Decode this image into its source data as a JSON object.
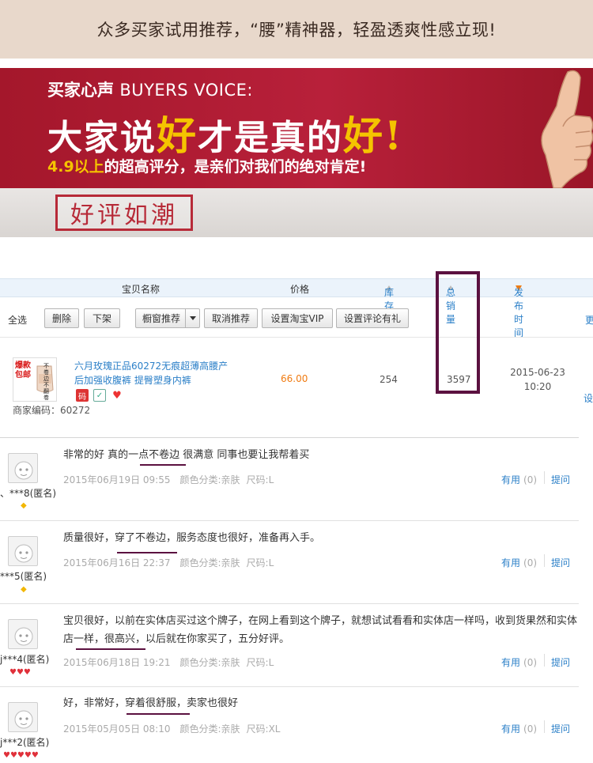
{
  "banner": {
    "text": "众多买家试用推荐，“腰”精神器，轻盈透爽性感立现!"
  },
  "voice": {
    "label_cn": "买家心声",
    "label_en": "BUYERS VOICE:",
    "headline_pre": "大家说",
    "headline_hl1": "好",
    "headline_mid": "才是真的",
    "headline_hl2": "好",
    "headline_end": "!",
    "sub_hl": "4.9以上",
    "sub_rest": "的超高评分，是亲们对我们的绝对肯定!",
    "stamp": "好评如潮"
  },
  "table": {
    "col_name": "宝贝名称",
    "col_price": "价格",
    "col_stock": "库存",
    "col_sales": "总销量",
    "col_date": "发布时间"
  },
  "toolbar": {
    "select_all": "全选",
    "delete": "删除",
    "offshelf": "下架",
    "window_recommend": "橱窗推荐",
    "cancel_recommend": "取消推荐",
    "set_vip": "设置淘宝VIP",
    "set_review_gift": "设置评论有礼",
    "more": "更"
  },
  "product": {
    "title": "六月玫瑰正品60272无痕超薄高腰产后加强收腹裤 提臀塑身内裤",
    "image_text_red": "爆款包邮",
    "image_text_black": "不卷边不翻卷",
    "icon_code": "码",
    "code": "商家编码：60272",
    "price": "66.00",
    "stock": "254",
    "sales": "3597",
    "date": "2015-06-23",
    "time": "10:20",
    "edit_cut": "设"
  },
  "reviews": [
    {
      "user": "、***8(匿名)",
      "text": "非常的好 真的一点不卷边 很满意 同事也要让我帮着买",
      "date": "2015年06月19日 09:55",
      "color": "颜色分类:亲肤",
      "size": "尺码:L",
      "useful_label": "有用",
      "useful_count": "(0)",
      "ask": "提问",
      "badge": "◆"
    },
    {
      "user": "***5(匿名)",
      "text": "质量很好，穿了不卷边，服务态度也很好，准备再入手。",
      "date": "2015年06月16日 22:37",
      "color": "颜色分类:亲肤",
      "size": "尺码:L",
      "useful_label": "有用",
      "useful_count": "(0)",
      "ask": "提问",
      "badge": "◆"
    },
    {
      "user": "j***4(匿名)",
      "text": "宝贝很好，以前在实体店买过这个牌子，在网上看到这个牌子，就想试试看看和实体店一样吗，收到货果然和实体店一样，很高兴，以后就在你家买了，五分好评。",
      "date": "2015年06月18日 19:21",
      "color": "颜色分类:亲肤",
      "size": "尺码:L",
      "useful_label": "有用",
      "useful_count": "(0)",
      "ask": "提问",
      "badge": "♥♥♥"
    },
    {
      "user": "j***2(匿名)",
      "text": "好，非常好，穿着很舒服，卖家也很好",
      "date": "2015年05月05日 08:10",
      "color": "颜色分类:亲肤",
      "size": "尺码:XL",
      "useful_label": "有用",
      "useful_count": "(0)",
      "ask": "提问",
      "badge": "♥♥♥♥♥"
    }
  ],
  "colors": {
    "accent_red": "#a4172b",
    "gold": "#f5c400",
    "link_blue": "#2c80c8",
    "price_orange": "#f07b12",
    "highlight": "#5b1140"
  }
}
